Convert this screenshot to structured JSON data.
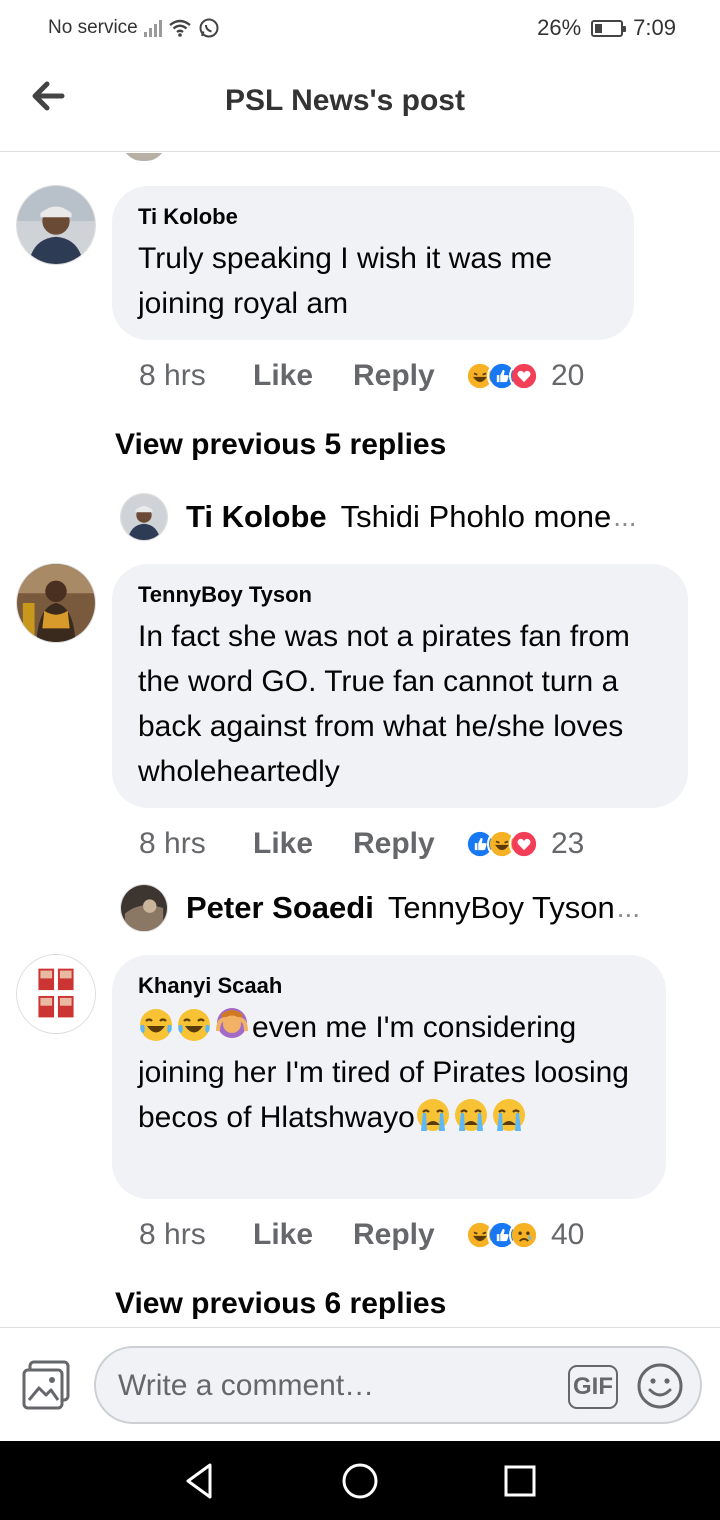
{
  "status_bar": {
    "carrier": "No service",
    "battery_pct": "26%",
    "battery_level": 0.26,
    "time": "7:09"
  },
  "header": {
    "title": "PSL News's post",
    "back_icon": "arrow-left-icon"
  },
  "comments": [
    {
      "author": "Ti Kolobe",
      "text": "Truly speaking I wish it was me joining royal am",
      "time": "8 hrs",
      "like_label": "Like",
      "reply_label": "Reply",
      "reactions": [
        "haha",
        "like",
        "love"
      ],
      "reaction_count": "20"
    },
    {
      "author": "TennyBoy Tyson",
      "text": "In fact she was not a pirates fan from the word GO. True fan cannot turn a back against from what he/she loves wholeheartedly",
      "time": "8 hrs",
      "like_label": "Like",
      "reply_label": "Reply",
      "reactions": [
        "like",
        "haha",
        "love"
      ],
      "reaction_count": "23"
    },
    {
      "author": "Khanyi Scaah",
      "text_main": "even me I'm considering joining her I'm tired of Pirates loosing becos of Hlatshwayo",
      "time": "8 hrs",
      "like_label": "Like",
      "reply_label": "Reply",
      "reactions": [
        "haha",
        "like",
        "sad"
      ],
      "reaction_count": "40"
    }
  ],
  "view_previous": [
    "View previous 5 replies",
    "View previous 6 replies"
  ],
  "reply_previews": [
    {
      "author": "Ti Kolobe",
      "snippet": "Tshidi Phohlo mone",
      "ellipsis": "..."
    },
    {
      "author": "Peter Soaedi",
      "snippet": "TennyBoy Tyson",
      "ellipsis": "..."
    }
  ],
  "composer": {
    "placeholder": "Write a comment…",
    "gif_label": "GIF"
  },
  "colors": {
    "bubble": "#f0f2f5",
    "meta_text": "#65676b",
    "like_blue": "#1877f2",
    "love_red": "#f33e58",
    "haha_yellow": "#f7b125"
  }
}
